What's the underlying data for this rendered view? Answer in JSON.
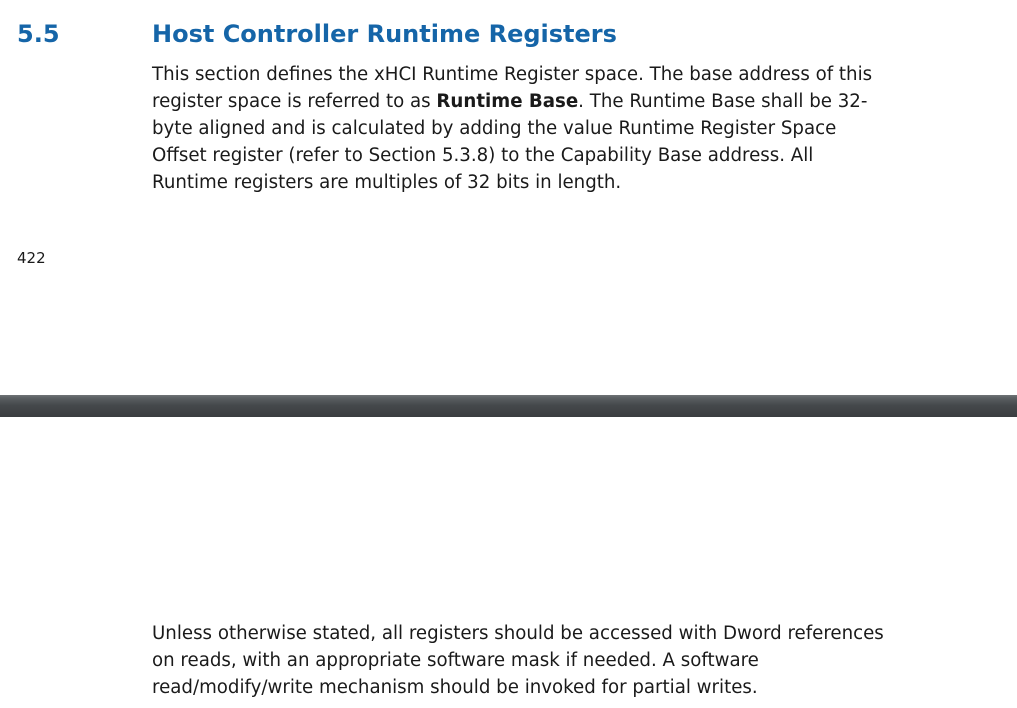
{
  "section": {
    "number": "5.5",
    "title": "Host Controller Runtime Registers"
  },
  "paragraph1": {
    "line1": "This section defines the xHCI Runtime Register space. The base address of this",
    "line2_before": "register space is referred to as ",
    "line2_bold": "Runtime Base",
    "line2_after": ". The Runtime Base shall be 32-",
    "line3": "byte aligned and is calculated by adding the value Runtime Register Space",
    "line4": "Offset register (refer to Section 5.3.8) to the Capability Base address. All",
    "line5": "Runtime registers are multiples of 32 bits in length."
  },
  "page_number": "422",
  "paragraph2": {
    "line1": "Unless otherwise stated, all registers should be accessed with Dword references",
    "line2": "on reads, with an appropriate software mask if needed. A software",
    "line3": "read/modify/write mechanism should be invoked for partial writes."
  }
}
